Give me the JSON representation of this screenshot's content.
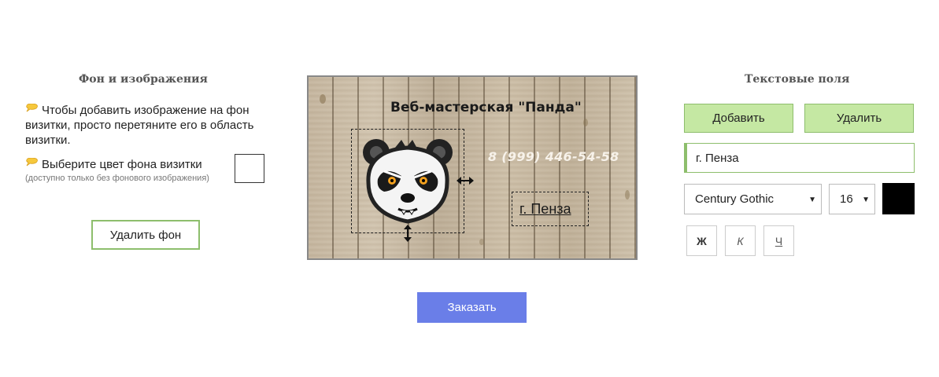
{
  "left_panel": {
    "title": "Фон и изображения",
    "hint_drag": "Чтобы добавить изображение на фон визитки, просто перетяните его в область визитки.",
    "hint_color": "Выберите цвет фона визитки",
    "hint_color_note": "(доступно только без фонового изображения)",
    "remove_background_label": "Удалить фон",
    "hint_icon": "speech-bubble-icon"
  },
  "card": {
    "title": "Веб-мастерская \"Панда\"",
    "phone": "8 (999) 446-54-58",
    "city": "г. Пенза",
    "background": "wood-planks",
    "image": "panda-logo"
  },
  "order_label": "Заказать",
  "right_panel": {
    "title": "Текстовые поля",
    "add_label": "Добавить",
    "delete_label": "Удалить",
    "text_value": "г. Пенза",
    "font_value": "Century Gothic",
    "size_value": "16",
    "text_color": "#000000",
    "bold_label": "Ж",
    "italic_label": "К",
    "underline_label": "Ч"
  },
  "colors": {
    "accent_green": "#8dbe6c",
    "button_green": "#c5e8a3",
    "order_blue": "#6a7ee8"
  }
}
